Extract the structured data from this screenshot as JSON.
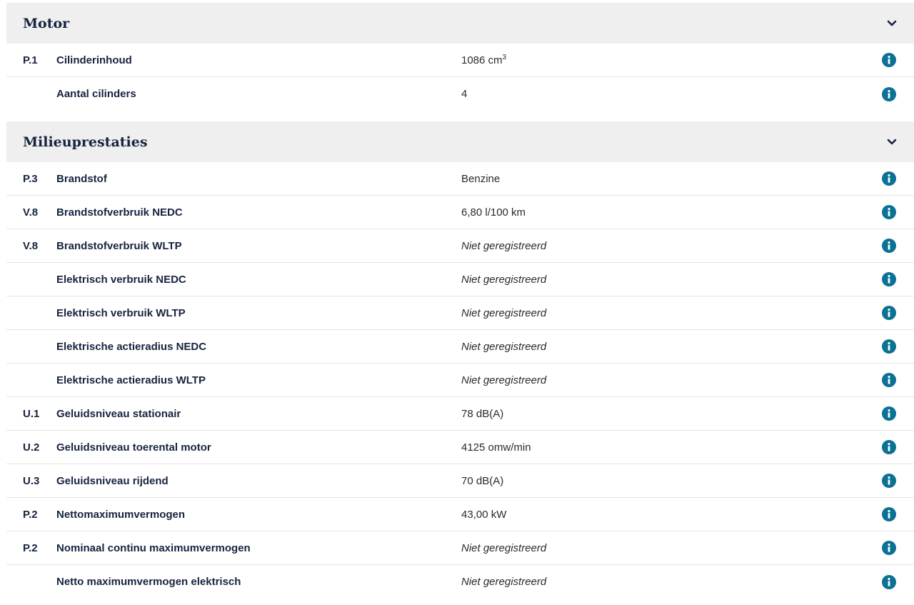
{
  "sections": [
    {
      "title": "Motor",
      "rows": [
        {
          "code": "P.1",
          "label": "Cilinderinhoud",
          "value": "1086 cm",
          "value_sup": "3",
          "missing": false
        },
        {
          "code": "",
          "label": "Aantal cilinders",
          "value": "4",
          "missing": false
        }
      ]
    },
    {
      "title": "Milieuprestaties",
      "rows": [
        {
          "code": "P.3",
          "label": "Brandstof",
          "value": "Benzine",
          "missing": false
        },
        {
          "code": "V.8",
          "label": "Brandstofverbruik NEDC",
          "value": "6,80 l/100 km",
          "missing": false
        },
        {
          "code": "V.8",
          "label": "Brandstofverbruik WLTP",
          "value": "Niet geregistreerd",
          "missing": true
        },
        {
          "code": "",
          "label": "Elektrisch verbruik NEDC",
          "value": "Niet geregistreerd",
          "missing": true
        },
        {
          "code": "",
          "label": "Elektrisch verbruik WLTP",
          "value": "Niet geregistreerd",
          "missing": true
        },
        {
          "code": "",
          "label": "Elektrische actieradius NEDC",
          "value": "Niet geregistreerd",
          "missing": true
        },
        {
          "code": "",
          "label": "Elektrische actieradius WLTP",
          "value": "Niet geregistreerd",
          "missing": true
        },
        {
          "code": "U.1",
          "label": "Geluidsniveau stationair",
          "value": "78 dB(A)",
          "missing": false
        },
        {
          "code": "U.2",
          "label": "Geluidsniveau toerental motor",
          "value": "4125 omw/min",
          "missing": false
        },
        {
          "code": "U.3",
          "label": "Geluidsniveau rijdend",
          "value": "70 dB(A)",
          "missing": false
        },
        {
          "code": "P.2",
          "label": "Nettomaximumvermogen",
          "value": "43,00 kW",
          "missing": false
        },
        {
          "code": "P.2",
          "label": "Nominaal continu maximumvermogen",
          "value": "Niet geregistreerd",
          "missing": true
        },
        {
          "code": "",
          "label": "Netto maximumvermogen elektrisch",
          "value": "Niet geregistreerd",
          "missing": true
        }
      ]
    }
  ],
  "icons": {
    "section_toggle": "chevron-down-icon",
    "row_info": "info-icon"
  },
  "colors": {
    "header_bg": "#efefef",
    "text_dark": "#17243f",
    "info_accent": "#0b7195",
    "divider": "#e4e4e4"
  }
}
